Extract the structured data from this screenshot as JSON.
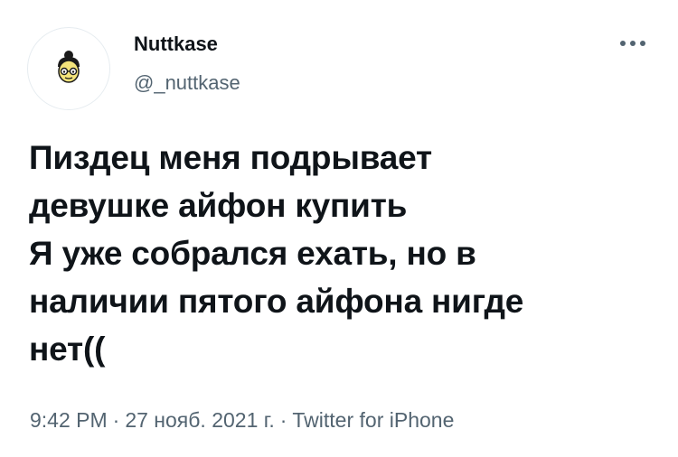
{
  "author": {
    "display_name": "Nuttkase",
    "handle": "@_nuttkase",
    "avatar_icon": "cartoon-face-avatar-icon"
  },
  "more_icon": "more-options-icon",
  "tweet": {
    "lines": [
      "Пиздец меня подрывает",
      "девушке айфон купить",
      "Я уже собрался ехать, но в",
      "наличии пятого айфона нигде",
      "нет(("
    ]
  },
  "meta": {
    "time": "9:42 PM",
    "separator": "·",
    "date": "27 нояб. 2021 г.",
    "source": "Twitter for iPhone"
  },
  "colors": {
    "text_primary": "#0f1419",
    "text_secondary": "#536471",
    "background": "#ffffff"
  }
}
